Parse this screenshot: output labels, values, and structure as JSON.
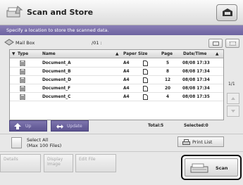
{
  "header": {
    "title": "Scan and Store",
    "prompt": "Specify a location to store the scanned data."
  },
  "location": {
    "name": "Mail Box",
    "path": "/01 :"
  },
  "table": {
    "columns": {
      "type": "Type",
      "name": "Name",
      "paper_size": "Paper Size",
      "page": "Page",
      "datetime": "Date/Time"
    },
    "rows": [
      {
        "name": "Document_A",
        "paper": "A4",
        "pages": "5",
        "datetime": "08/08 17:33"
      },
      {
        "name": "Document_B",
        "paper": "A4",
        "pages": "8",
        "datetime": "08/08 17:34"
      },
      {
        "name": "Document_D",
        "paper": "A4",
        "pages": "12",
        "datetime": "08/08 17:34"
      },
      {
        "name": "Document_F",
        "paper": "A4",
        "pages": "20",
        "datetime": "08/08 17:34"
      },
      {
        "name": "Document_C",
        "paper": "A4",
        "pages": "4",
        "datetime": "08/08 17:35"
      }
    ]
  },
  "pagination": {
    "page": "1/1"
  },
  "nav": {
    "up_label": "Up",
    "update_label": "Update",
    "total": "Total:5",
    "selected": "Selected:0"
  },
  "select_all": {
    "line1": "Select All",
    "line2": "(Max 100 Files)"
  },
  "print_list_label": "Print List",
  "bottom": {
    "details": "Details",
    "display_line1": "Display",
    "display_line2": "Image",
    "edit_file": "Edit File",
    "scan": "Scan"
  },
  "colors": {
    "prompt_bar": "#7a70ac",
    "nav_bar": "#6d63a0"
  }
}
